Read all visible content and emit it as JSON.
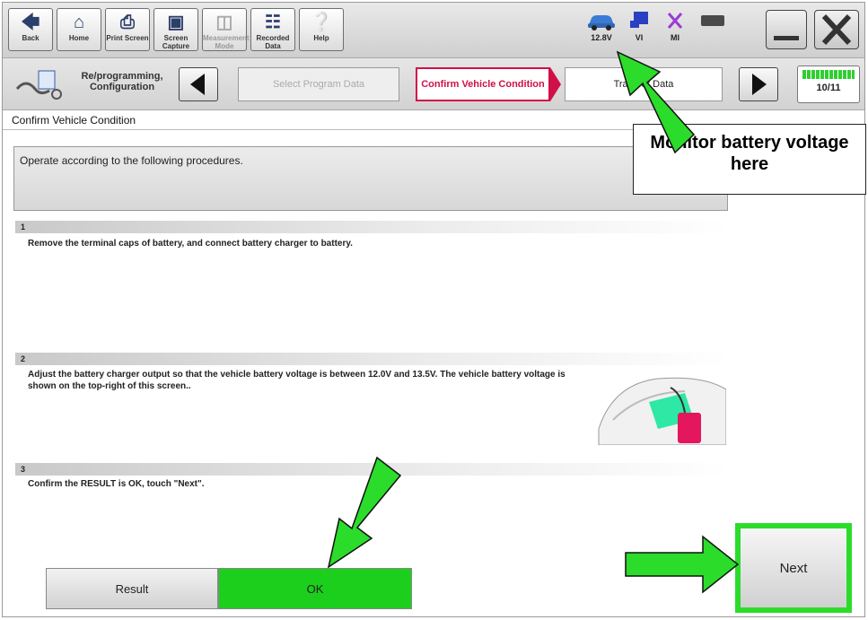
{
  "toolbar": {
    "buttons": [
      {
        "label": "Back",
        "icon": "back-arrow-icon"
      },
      {
        "label": "Home",
        "icon": "home-icon"
      },
      {
        "label": "Print Screen",
        "icon": "printer-icon"
      },
      {
        "label": "Screen Capture",
        "icon": "camera-icon"
      },
      {
        "label": "Measurement Mode",
        "icon": "meter-icon"
      },
      {
        "label": "Recorded Data",
        "icon": "recorded-data-icon"
      },
      {
        "label": "Help",
        "icon": "help-icon"
      }
    ],
    "status": {
      "voltage": "12.8V",
      "vi": "VI",
      "mi": "MI"
    }
  },
  "stepbar": {
    "section_label": "Re/programming, Configuration",
    "steps": [
      {
        "label": "Select Program Data",
        "state": "inactive"
      },
      {
        "label": "Confirm Vehicle Condition",
        "state": "active"
      },
      {
        "label": "Transfer Data",
        "state": "next"
      }
    ],
    "progress": "10/11"
  },
  "page_title": "Confirm Vehicle Condition",
  "instruction": "Operate according to the following procedures.",
  "steps": [
    {
      "number": "1",
      "text": "Remove the terminal caps of battery, and connect battery charger to battery."
    },
    {
      "number": "2",
      "text": "Adjust the battery charger output so that the vehicle battery voltage is between 12.0V and 13.5V. The vehicle battery voltage is shown on the top-right of this screen.."
    },
    {
      "number": "3",
      "text": "Confirm the RESULT is OK, touch \"Next\"."
    }
  ],
  "result": {
    "label": "Result",
    "value": "OK"
  },
  "next_label": "Next",
  "annotation": "Monitor battery voltage here",
  "colors": {
    "accent": "#d01048",
    "ok_green": "#1ccf1c",
    "arrow_green": "#2bdc2b",
    "highlight_border": "#2bdc2b"
  }
}
